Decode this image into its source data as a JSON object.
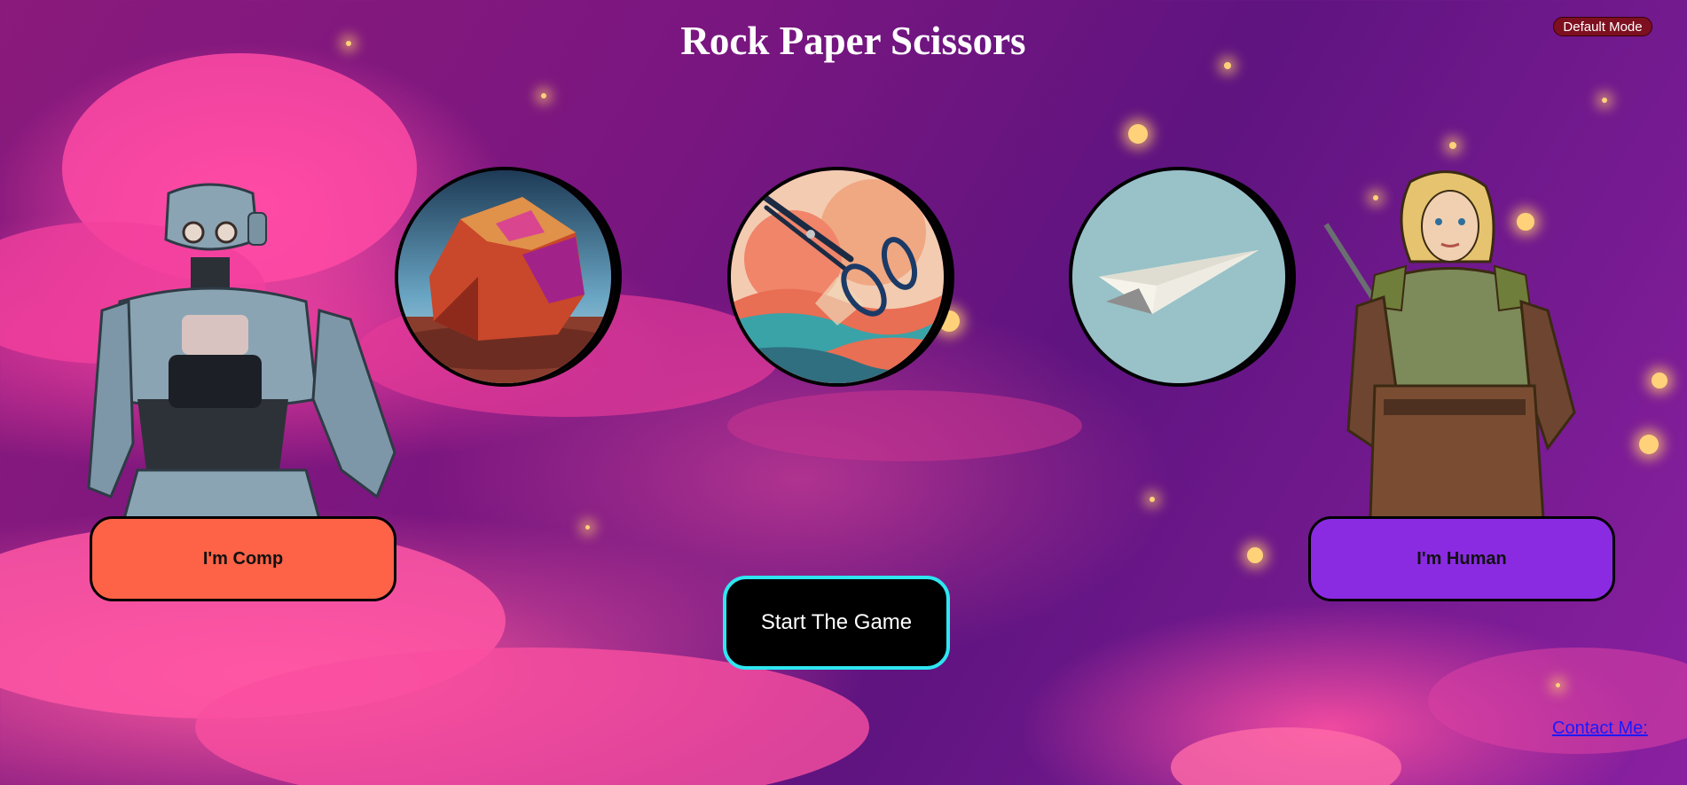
{
  "page": {
    "title": "Rock Paper Scissors"
  },
  "mode_toggle": {
    "label": "Default Mode"
  },
  "choices": [
    {
      "name": "rock",
      "icon": "rock-image"
    },
    {
      "name": "scissors",
      "icon": "scissors-image"
    },
    {
      "name": "paper",
      "icon": "paper-airplane-image"
    }
  ],
  "players": {
    "computer": {
      "label": "I'm Comp",
      "color": "#ff6347"
    },
    "human": {
      "label": "I'm Human",
      "color": "#8a2be2"
    }
  },
  "start_button": {
    "label": "Start The Game",
    "border_color": "#2ee6f0"
  },
  "footer": {
    "contact_label": "Contact Me:"
  }
}
